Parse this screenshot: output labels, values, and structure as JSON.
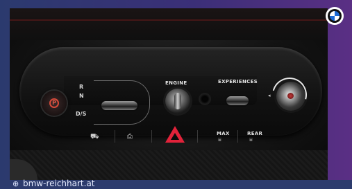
{
  "gear_labels": {
    "r": "R",
    "n": "N",
    "ds": "D/S"
  },
  "labels": {
    "engine": "ENGINE",
    "experiences": "EXPERIENCES",
    "max": "MAX",
    "rear": "REAR",
    "epb_symbol": "P"
  },
  "icons": {
    "parking_brake": "parking-brake-icon",
    "engine_knob": "engine-start-knob",
    "hazard": "hazard-triangle-icon",
    "volume": "volume-knob",
    "front_defrost": "front-defrost-icon",
    "rear_defrost": "rear-defrost-icon",
    "assist": "driving-assist-icon",
    "logo": "bmw-logo"
  },
  "colors": {
    "hazard": "#e2223a",
    "frame_left": "#2b3a6e",
    "frame_right": "#5a2f84",
    "logo_blue": "#1c69d3"
  },
  "footer": {
    "url": "bmw-reichhart.at"
  }
}
